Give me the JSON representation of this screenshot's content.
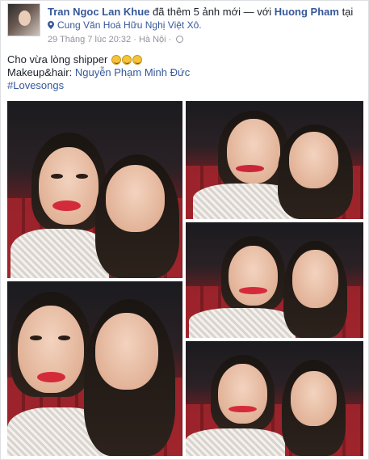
{
  "post": {
    "author": "Tran Ngoc Lan Khue",
    "action_text": "đã thêm 5 ảnh mới — với",
    "tagged": "Huong Pham",
    "at_text": "tại",
    "location": "Cung Văn Hoá Hữu Nghị Việt Xô.",
    "date": "29 Tháng 7 lúc 20:32",
    "separator": "·",
    "city": "Hà Nội",
    "audience_icon": "globe-icon",
    "location_icon": "map-pin-icon",
    "caption_line1": "Cho vừa lòng shipper",
    "caption_emojis": [
      "grinning-face-emoji",
      "grinning-face-emoji",
      "grinning-face-emoji"
    ],
    "makeup_label": "Makeup&hair:",
    "makeup_name": "Nguyễn Phạm Minh Đức",
    "hashtag": "#Lovesongs",
    "photo_count": 5
  },
  "colors": {
    "link": "#365899",
    "meta": "#90949c",
    "text": "#1d2129",
    "border": "#dddfe2",
    "seat_red": "#a3242c"
  }
}
